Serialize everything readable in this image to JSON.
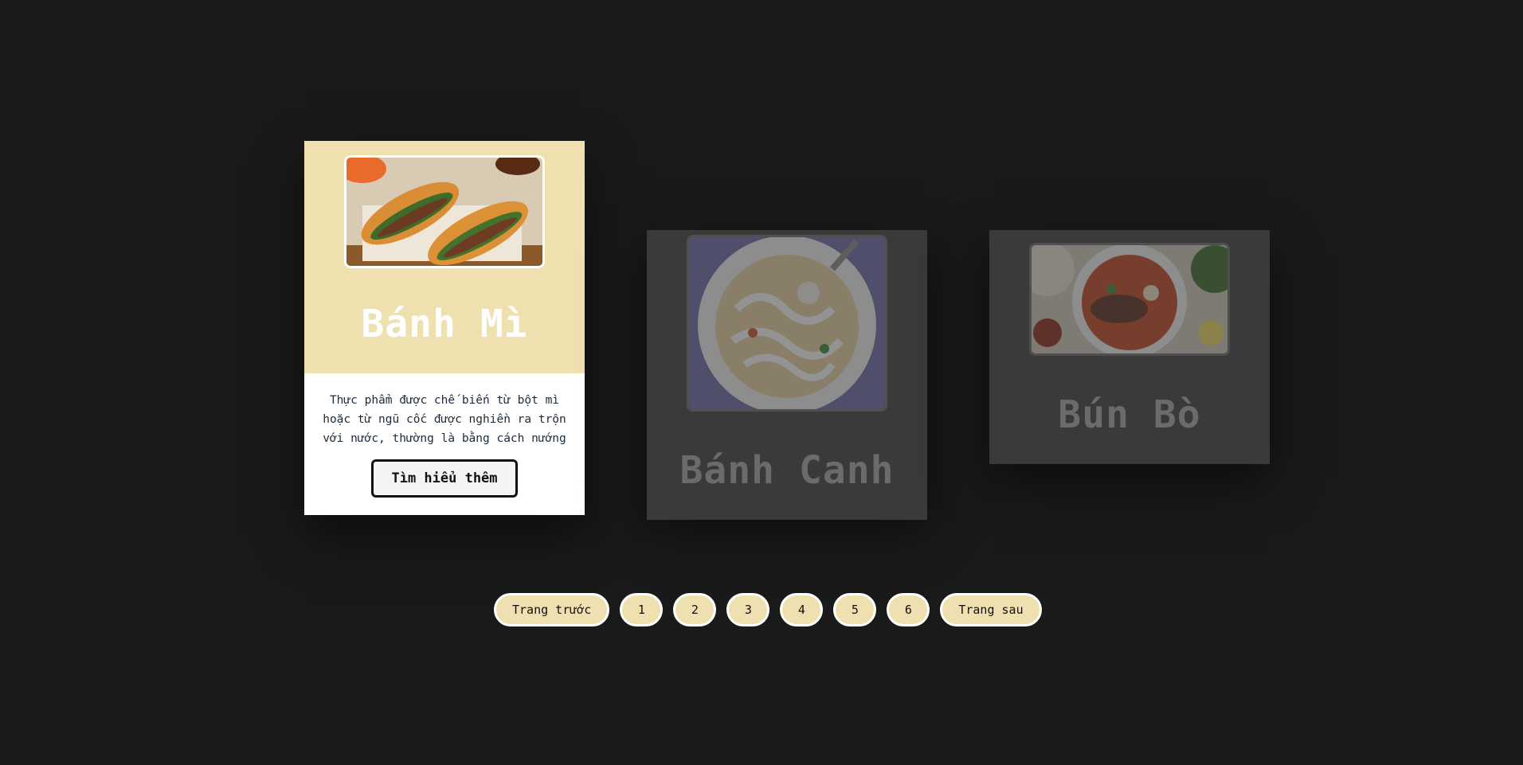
{
  "cards": [
    {
      "title": "Bánh Mì",
      "description": "Thực phẩm được chế biến từ bột mì hoặc từ ngũ cốc được nghiền ra trộn với nước, thường là bằng cách nướng",
      "button_label": "Tìm hiểu thêm",
      "image": "banh-mi-photo"
    },
    {
      "title": "Bánh Canh",
      "image": "banh-canh-photo"
    },
    {
      "title": "Bún Bò",
      "image": "bun-bo-photo"
    }
  ],
  "pagination": {
    "prev_label": "Trang trước",
    "next_label": "Trang sau",
    "pages": [
      "1",
      "2",
      "3",
      "4",
      "5",
      "6"
    ]
  },
  "colors": {
    "background": "#1a1a1a",
    "accent": "#efe0b0",
    "inactive_card": "#3a3a3a"
  }
}
